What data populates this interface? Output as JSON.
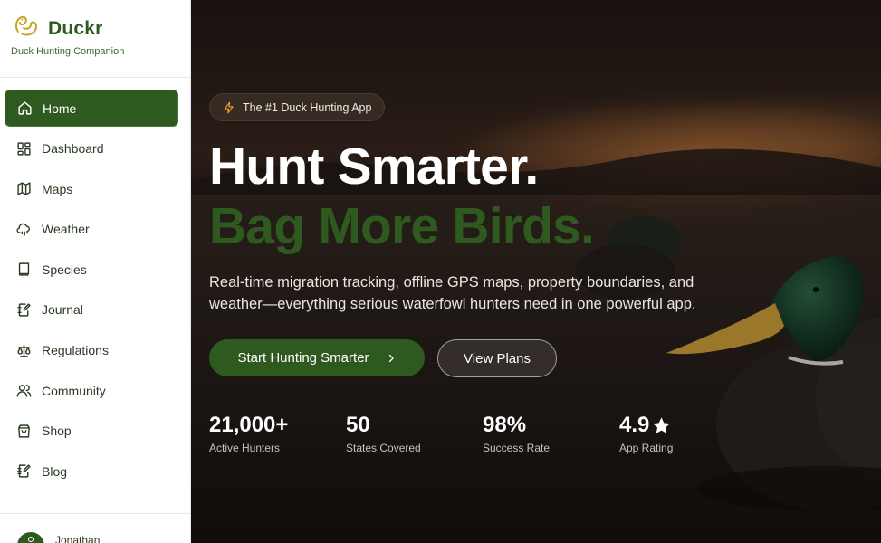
{
  "brand": {
    "name": "Duckr",
    "tagline": "Duck Hunting Companion",
    "logo_icon": "duck-logo-icon",
    "color": "#2f5a1f"
  },
  "nav": {
    "items": [
      {
        "label": "Home",
        "icon": "home-icon",
        "active": true
      },
      {
        "label": "Dashboard",
        "icon": "dashboard-icon"
      },
      {
        "label": "Maps",
        "icon": "map-icon"
      },
      {
        "label": "Weather",
        "icon": "weather-icon"
      },
      {
        "label": "Species",
        "icon": "book-icon"
      },
      {
        "label": "Journal",
        "icon": "journal-icon"
      },
      {
        "label": "Regulations",
        "icon": "scale-icon"
      },
      {
        "label": "Community",
        "icon": "users-icon"
      },
      {
        "label": "Shop",
        "icon": "shopping-bag-icon"
      },
      {
        "label": "Blog",
        "icon": "blog-icon"
      }
    ]
  },
  "user": {
    "name": "Jonathan"
  },
  "hero": {
    "badge": "The #1 Duck Hunting App",
    "badge_icon": "lightning-icon",
    "headline_1": "Hunt Smarter.",
    "headline_2": "Bag More Birds.",
    "description": "Real-time migration tracking, offline GPS maps, property boundaries, and weather—everything serious waterfowl hunters need in one powerful app.",
    "primary_cta": "Start Hunting Smarter",
    "secondary_cta": "View Plans"
  },
  "stats": [
    {
      "value": "21,000+",
      "label": "Active Hunters"
    },
    {
      "value": "50",
      "label": "States Covered"
    },
    {
      "value": "98%",
      "label": "Success Rate"
    },
    {
      "value": "4.9",
      "label": "App Rating",
      "icon": "star-icon"
    }
  ],
  "colors": {
    "accent": "#2f5a1f",
    "badge_icon": "#f0a030"
  }
}
